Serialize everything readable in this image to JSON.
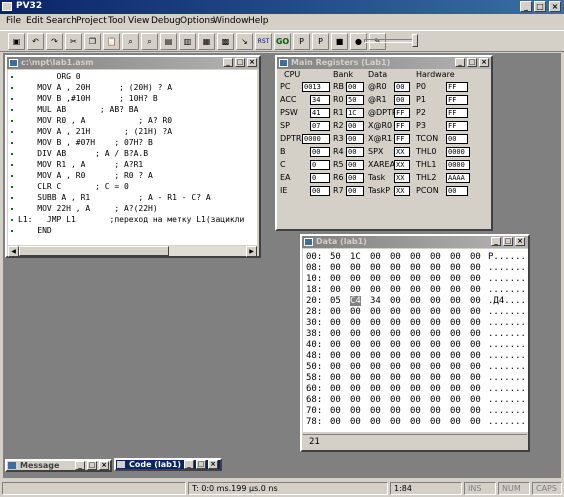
{
  "app": {
    "title": "PV32",
    "win_buttons": [
      "_",
      "□",
      "×"
    ]
  },
  "menu": [
    "File",
    "Edit",
    "Search",
    "Project",
    "Tool",
    "View",
    "Debug",
    "Options",
    "Window",
    "Help"
  ],
  "toolbar": {
    "buttons": [
      {
        "name": "compile-icon",
        "glyph": "▣"
      },
      {
        "name": "undo-icon",
        "glyph": "↶"
      },
      {
        "name": "redo-icon",
        "glyph": "↷"
      },
      {
        "name": "cut-icon",
        "glyph": "✂"
      },
      {
        "name": "copy-icon",
        "glyph": "❐"
      },
      {
        "name": "paste-icon",
        "glyph": "📋"
      },
      {
        "name": "find-icon",
        "glyph": "⌕"
      },
      {
        "name": "find-next-icon",
        "glyph": "⌕"
      },
      {
        "name": "bookmark-icon",
        "glyph": "▤"
      },
      {
        "name": "toggle-bookmark-icon",
        "glyph": "▥"
      },
      {
        "name": "window-icon",
        "glyph": "▦"
      },
      {
        "name": "chip-icon",
        "glyph": "▩"
      },
      {
        "name": "step-icon",
        "glyph": "↘"
      },
      {
        "name": "reset-icon",
        "glyph": "RST"
      },
      {
        "name": "go-icon",
        "glyph": "GO"
      },
      {
        "name": "step-into-icon",
        "glyph": "P"
      },
      {
        "name": "step-over-icon",
        "glyph": "P"
      },
      {
        "name": "stop-icon",
        "glyph": "■"
      },
      {
        "name": "breakpoint-icon",
        "glyph": "●"
      },
      {
        "name": "tools-icon",
        "glyph": "✎"
      }
    ]
  },
  "code_window": {
    "title": "c:\\mpt\\lab1.asm",
    "lines": [
      "        ORG 0",
      "    MOV A , 20H      ; (20H) ? A",
      "    MOV B ,#10H      ; 10H? B",
      "    MUL AB       ; AB? BA",
      "    MOV R0 , A           ; A? R0",
      "    MOV A , 21H       ; (21H) ?A",
      "    MOV B , #07H    ; 07H? B",
      "    DIV AB      ; A / B?A.B",
      "    MOV R1 , A      ; A?R1",
      "    MOV A , R0      ; R0 ? A",
      "    CLR C       ; C = 0",
      "    SUBB A , R1          ; A - R1 - C? A",
      "    MOV 22H , A     ; A?(22H)",
      "L1:   JMP L1       ;переход на метку L1(зацикли",
      "    END"
    ]
  },
  "registers_window": {
    "title": "Main Registers (Lab1)",
    "headers": {
      "cpu": "CPU",
      "bank": "Bank",
      "data": "Data",
      "hardware": "Hardware"
    },
    "cpu": [
      {
        "label": "PC",
        "value": "0013"
      },
      {
        "label": "ACC",
        "value": "34"
      },
      {
        "label": "PSW",
        "value": "41"
      },
      {
        "label": "SP",
        "value": "07"
      },
      {
        "label": "DPTR",
        "value": "0000"
      },
      {
        "label": "B",
        "value": "00"
      },
      {
        "label": "C",
        "value": "0"
      },
      {
        "label": "EA",
        "value": "0"
      },
      {
        "label": "IE",
        "value": "00"
      }
    ],
    "bank": [
      {
        "label": "RB",
        "value": "00"
      },
      {
        "label": "R0",
        "value": "50"
      },
      {
        "label": "R1",
        "value": "1C"
      },
      {
        "label": "R2",
        "value": "00"
      },
      {
        "label": "R3",
        "value": "00"
      },
      {
        "label": "R4",
        "value": "00"
      },
      {
        "label": "R5",
        "value": "00"
      },
      {
        "label": "R6",
        "value": "00"
      },
      {
        "label": "R7",
        "value": "00"
      }
    ],
    "data": [
      {
        "label": "@R0",
        "value": "00"
      },
      {
        "label": "@R1",
        "value": "00"
      },
      {
        "label": "@DPTR",
        "value": "FF"
      },
      {
        "label": "X@R0",
        "value": "FF"
      },
      {
        "label": "X@R1",
        "value": "FF"
      },
      {
        "label": "SPX",
        "value": "XX"
      },
      {
        "label": "XAREA",
        "value": "XX"
      },
      {
        "label": "Task",
        "value": "XX"
      },
      {
        "label": "TaskP",
        "value": "XX"
      }
    ],
    "hardware": [
      {
        "label": "P0",
        "value": "FF"
      },
      {
        "label": "P1",
        "value": "FF"
      },
      {
        "label": "P2",
        "value": "FF"
      },
      {
        "label": "P3",
        "value": "FF"
      },
      {
        "label": "TCON",
        "value": "00"
      },
      {
        "label": "THL0",
        "value": "0000"
      },
      {
        "label": "THL1",
        "value": "0000"
      },
      {
        "label": "THL2",
        "value": "AAAA"
      },
      {
        "label": "PCON",
        "value": "00"
      }
    ]
  },
  "data_window": {
    "title": "Data (lab1)",
    "rows": [
      {
        "addr": "00:",
        "bytes": [
          "50",
          "1C",
          "00",
          "00",
          "00",
          "00",
          "00",
          "00"
        ],
        "ascii": "P......."
      },
      {
        "addr": "08:",
        "bytes": [
          "00",
          "00",
          "00",
          "00",
          "00",
          "00",
          "00",
          "00"
        ],
        "ascii": "........"
      },
      {
        "addr": "10:",
        "bytes": [
          "00",
          "00",
          "00",
          "00",
          "00",
          "00",
          "00",
          "00"
        ],
        "ascii": "........"
      },
      {
        "addr": "18:",
        "bytes": [
          "00",
          "00",
          "00",
          "00",
          "00",
          "00",
          "00",
          "00"
        ],
        "ascii": "........"
      },
      {
        "addr": "20:",
        "bytes": [
          "05",
          "C4",
          "34",
          "00",
          "00",
          "00",
          "00",
          "00"
        ],
        "ascii": ".Д4....."
      },
      {
        "addr": "28:",
        "bytes": [
          "00",
          "00",
          "00",
          "00",
          "00",
          "00",
          "00",
          "00"
        ],
        "ascii": "........"
      },
      {
        "addr": "30:",
        "bytes": [
          "00",
          "00",
          "00",
          "00",
          "00",
          "00",
          "00",
          "00"
        ],
        "ascii": "........"
      },
      {
        "addr": "38:",
        "bytes": [
          "00",
          "00",
          "00",
          "00",
          "00",
          "00",
          "00",
          "00"
        ],
        "ascii": "........"
      },
      {
        "addr": "40:",
        "bytes": [
          "00",
          "00",
          "00",
          "00",
          "00",
          "00",
          "00",
          "00"
        ],
        "ascii": "........"
      },
      {
        "addr": "48:",
        "bytes": [
          "00",
          "00",
          "00",
          "00",
          "00",
          "00",
          "00",
          "00"
        ],
        "ascii": "........"
      },
      {
        "addr": "50:",
        "bytes": [
          "00",
          "00",
          "00",
          "00",
          "00",
          "00",
          "00",
          "00"
        ],
        "ascii": "........"
      },
      {
        "addr": "58:",
        "bytes": [
          "00",
          "00",
          "00",
          "00",
          "00",
          "00",
          "00",
          "00"
        ],
        "ascii": "........"
      },
      {
        "addr": "60:",
        "bytes": [
          "00",
          "00",
          "00",
          "00",
          "00",
          "00",
          "00",
          "00"
        ],
        "ascii": "........"
      },
      {
        "addr": "68:",
        "bytes": [
          "00",
          "00",
          "00",
          "00",
          "00",
          "00",
          "00",
          "00"
        ],
        "ascii": "........"
      },
      {
        "addr": "70:",
        "bytes": [
          "00",
          "00",
          "00",
          "00",
          "00",
          "00",
          "00",
          "00"
        ],
        "ascii": "........"
      },
      {
        "addr": "78:",
        "bytes": [
          "00",
          "00",
          "00",
          "00",
          "00",
          "00",
          "00",
          "00"
        ],
        "ascii": "........"
      }
    ],
    "footer": "21"
  },
  "minimized": {
    "message": "Message",
    "code": "Code (lab1)"
  },
  "status": {
    "time": "T: 0:0 ms.199 µs.0 ns",
    "position": "1:84",
    "ins": "INS",
    "num": "NUM",
    "caps": "CAPS"
  }
}
